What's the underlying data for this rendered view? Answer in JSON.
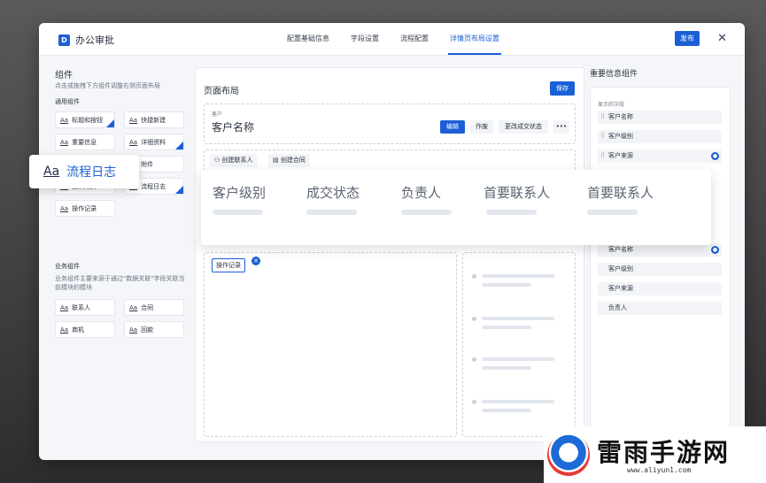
{
  "app": {
    "title": "办公审批",
    "logo_char": "D"
  },
  "nav": {
    "tabs": [
      "配置基础信息",
      "字段设置",
      "流程配置",
      "详情页布局设置"
    ],
    "active": "详情页布局设置"
  },
  "header": {
    "publish_label": "发布",
    "close_icon": "✕"
  },
  "left": {
    "title": "组件",
    "desc": "点击或拖拽下方组件调整右侧页面布局",
    "common_title": "通用组件",
    "common": [
      "标题和按钮",
      "快捷新建",
      "重要信息",
      "详细资料",
      "",
      "附件",
      "团队成员",
      "流程日志",
      "操作记录"
    ],
    "aa": "Aa",
    "biz_title": "业务组件",
    "biz_desc": "业务组件主要来源于通过\"数据关联\"字段关联当前模块的模块",
    "biz": [
      "联系人",
      "合同",
      "商机",
      "回款"
    ]
  },
  "mid": {
    "title": "页面布局",
    "save_label": "保存",
    "card_sub": "客户",
    "card_name": "客户名称",
    "edit_label": "编辑",
    "void_label": "作废",
    "change_label": "更改成交状态",
    "more_label": "•••",
    "action1": "创建联系人",
    "action2": "创建合同",
    "chip": "操作记录",
    "chip_x": "✕"
  },
  "right": {
    "title": "重要信息组件",
    "sub": "显示的字段",
    "items_top": [
      "客户名称",
      "客户级别",
      "客户来源"
    ],
    "items_bottom": [
      "客户名称",
      "客户级别",
      "客户来源",
      "负责人"
    ]
  },
  "popups": {
    "flow": {
      "aa": "Aa",
      "label": "流程日志"
    },
    "fields": [
      "客户级别",
      "成交状态",
      "负责人",
      "首要联系人",
      "首要联系人"
    ]
  },
  "watermark": {
    "text": "雷雨手游网",
    "url": "www.aliyun1.com"
  },
  "colors": {
    "accent": "#1b5fd6"
  }
}
